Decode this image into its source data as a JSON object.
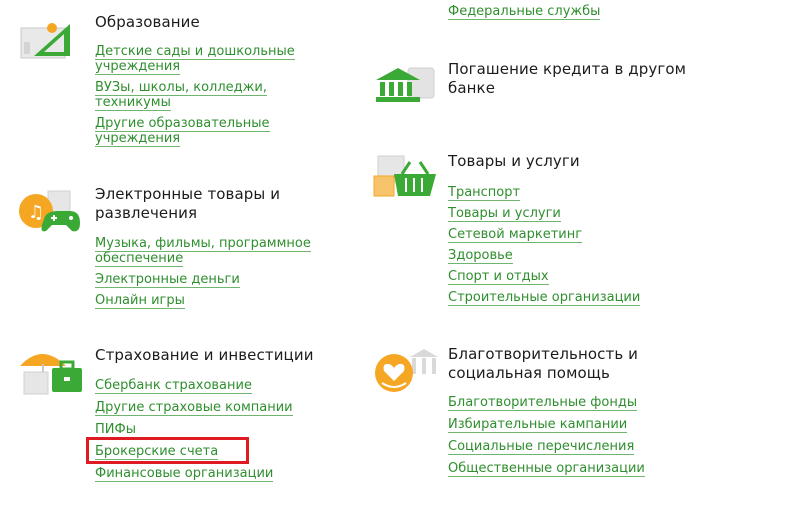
{
  "top_link": "Федеральные службы",
  "categories": {
    "education": {
      "icon": "education-icon",
      "title": "Образование",
      "links": [
        "Детские сады и дошкольные учреждения",
        "ВУЗы, школы, колледжи, техникумы",
        "Другие образовательные учреждения"
      ]
    },
    "loan": {
      "icon": "bank-icon",
      "title": "Погашение кредита в другом банке",
      "links": []
    },
    "goods": {
      "icon": "shopping-basket-icon",
      "title": "Товары и услуги",
      "links": [
        "Транспорт",
        "Товары и услуги",
        "Сетевой маркетинг",
        "Здоровье",
        "Спорт и отдых",
        "Строительные организации"
      ]
    },
    "entertainment": {
      "icon": "gamepad-music-icon",
      "title": "Электронные товары и развлечения",
      "links": [
        "Музыка, фильмы, программное обеспечение",
        "Электронные деньги",
        "Онлайн игры"
      ]
    },
    "insurance": {
      "icon": "umbrella-briefcase-icon",
      "title": "Страхование и инвестиции",
      "links": [
        "Сбербанк страхование",
        "Другие страховые компании",
        "ПИФы",
        "Брокерские счета",
        "Финансовые организации"
      ]
    },
    "charity": {
      "icon": "charity-heart-icon",
      "title": "Благотворительность и социальная помощь",
      "links": [
        "Благотворительные фонды",
        "Избирательные кампании",
        "Социальные перечисления",
        "Общественные организации"
      ]
    }
  },
  "colors": {
    "link": "#2f8f2f",
    "icon_green": "#3aa935",
    "icon_orange": "#f5a623",
    "highlight": "#e01a22"
  }
}
